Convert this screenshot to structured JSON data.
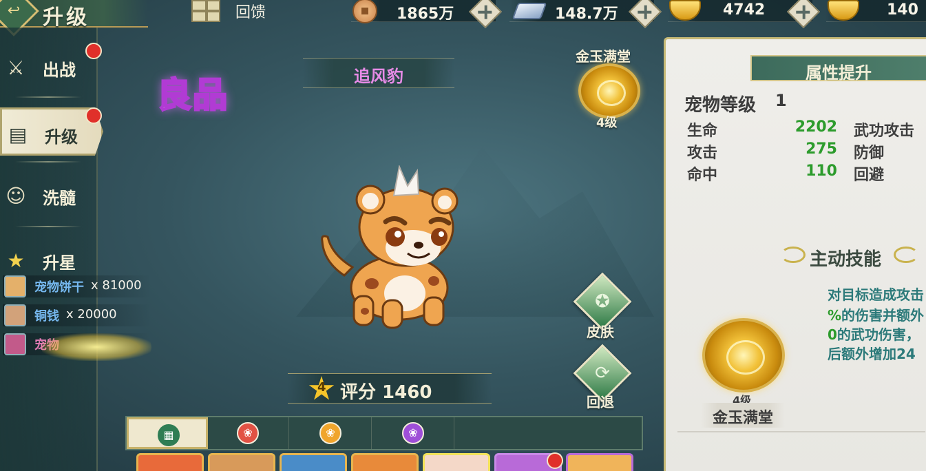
{
  "header": {
    "title": "升级",
    "feedback_label": "回馈",
    "resources": [
      {
        "icon": "copper-coin-icon",
        "value": "1865万"
      },
      {
        "icon": "silver-ingot-icon",
        "value": "148.7万"
      },
      {
        "icon": "gold-ingot-icon",
        "value": "4742"
      },
      {
        "icon": "gold-yuanbao-icon",
        "value": "140"
      }
    ]
  },
  "sidebar": {
    "items": [
      {
        "label": "出战",
        "icon": "crossed-swords-icon",
        "badge": true
      },
      {
        "label": "升级",
        "icon": "document-icon",
        "badge": true,
        "active": true
      },
      {
        "label": "洗髓",
        "icon": "cat-face-icon",
        "badge": false
      },
      {
        "label": "升星",
        "icon": "star-icon",
        "badge": false
      }
    ],
    "materials": [
      {
        "name": "宠物饼干",
        "count": "x 81000"
      },
      {
        "name": "铜钱",
        "count": "x 20000"
      },
      {
        "name": "宠物",
        "count": ""
      }
    ]
  },
  "stage": {
    "quality": "良品",
    "pet_name": "追风豹",
    "top_skill_name": "金玉满堂",
    "top_skill_level": "4级",
    "skin_label": "皮肤",
    "revert_label": "回退",
    "star_count": "4",
    "score_label": "评分 1460"
  },
  "panel": {
    "header": "属性提升",
    "pet_level_label": "宠物等级",
    "pet_level_value": "1",
    "stats": [
      {
        "name": "生命",
        "value": "2202"
      },
      {
        "name": "攻击",
        "value": "275"
      },
      {
        "name": "命中",
        "value": "110"
      }
    ],
    "stats_right": [
      "武功攻击",
      "防御",
      "回避"
    ],
    "skills_header": "主动技能",
    "skill_desc": [
      {
        "pre": "",
        "hl": "",
        "post": "对目标造成攻击"
      },
      {
        "pre": "",
        "hl": "%",
        "post": "的伤害并额外"
      },
      {
        "pre": "",
        "hl": "0",
        "post": "的武功伤害，"
      },
      {
        "pre": "",
        "hl": "",
        "post": "后额外增加24"
      }
    ],
    "skill_level": "4级",
    "skill_name": "金玉满堂"
  },
  "colors": {
    "accent_gold": "#d9b24c",
    "stat_green": "#2c9b2c",
    "quality_purple": "#b13bd4",
    "badge_red": "#e0302a"
  }
}
